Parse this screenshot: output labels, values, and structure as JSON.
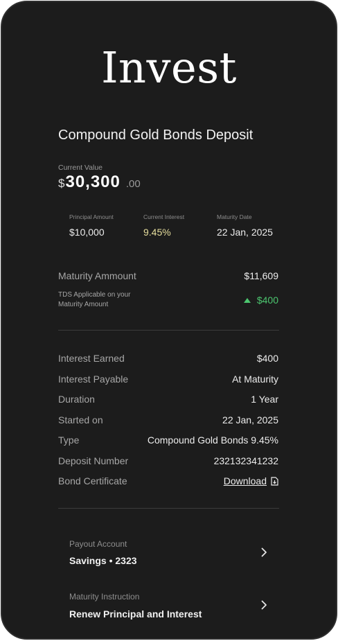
{
  "hero": {
    "title": "Invest"
  },
  "deposit": {
    "title": "Compound Gold Bonds Deposit",
    "current_value": {
      "label": "Current Value",
      "currency": "$",
      "amount": "30,300",
      "decimal": ".00"
    },
    "stats": [
      {
        "label": "Principal Amount",
        "value": "$10,000"
      },
      {
        "label": "Current Interest",
        "value": "9.45%"
      },
      {
        "label": "Maturity Date",
        "value": "22 Jan, 2025"
      }
    ],
    "maturity": {
      "label": "Maturity Ammount",
      "value": "$11,609",
      "tds_label_line1": "TDS Applicable on your",
      "tds_label_line2": "Maturity Amount",
      "tds_value": "$400"
    },
    "details": [
      {
        "label": "Interest Earned",
        "value": "$400"
      },
      {
        "label": "Interest Payable",
        "value": "At Maturity"
      },
      {
        "label": "Duration",
        "value": "1 Year"
      },
      {
        "label": "Started on",
        "value": "22 Jan, 2025"
      },
      {
        "label": "Type",
        "value": "Compound Gold Bonds 9.45%"
      },
      {
        "label": "Deposit Number",
        "value": "232132341232"
      },
      {
        "label": "Bond Certificate",
        "value": "Download"
      }
    ],
    "payout": {
      "label": "Payout Account",
      "value": "Savings • 2323"
    },
    "instruction": {
      "label": "Maturity Instruction",
      "value": "Renew Principal and Interest"
    }
  },
  "colors": {
    "background": "#1c1c1c",
    "accent_gold": "#e7df9e",
    "positive_green": "#4cc66f"
  },
  "icons": {
    "tds_indicator": "triangle-up-icon",
    "certificate": "document-download-icon",
    "row_action": "chevron-right-icon"
  }
}
